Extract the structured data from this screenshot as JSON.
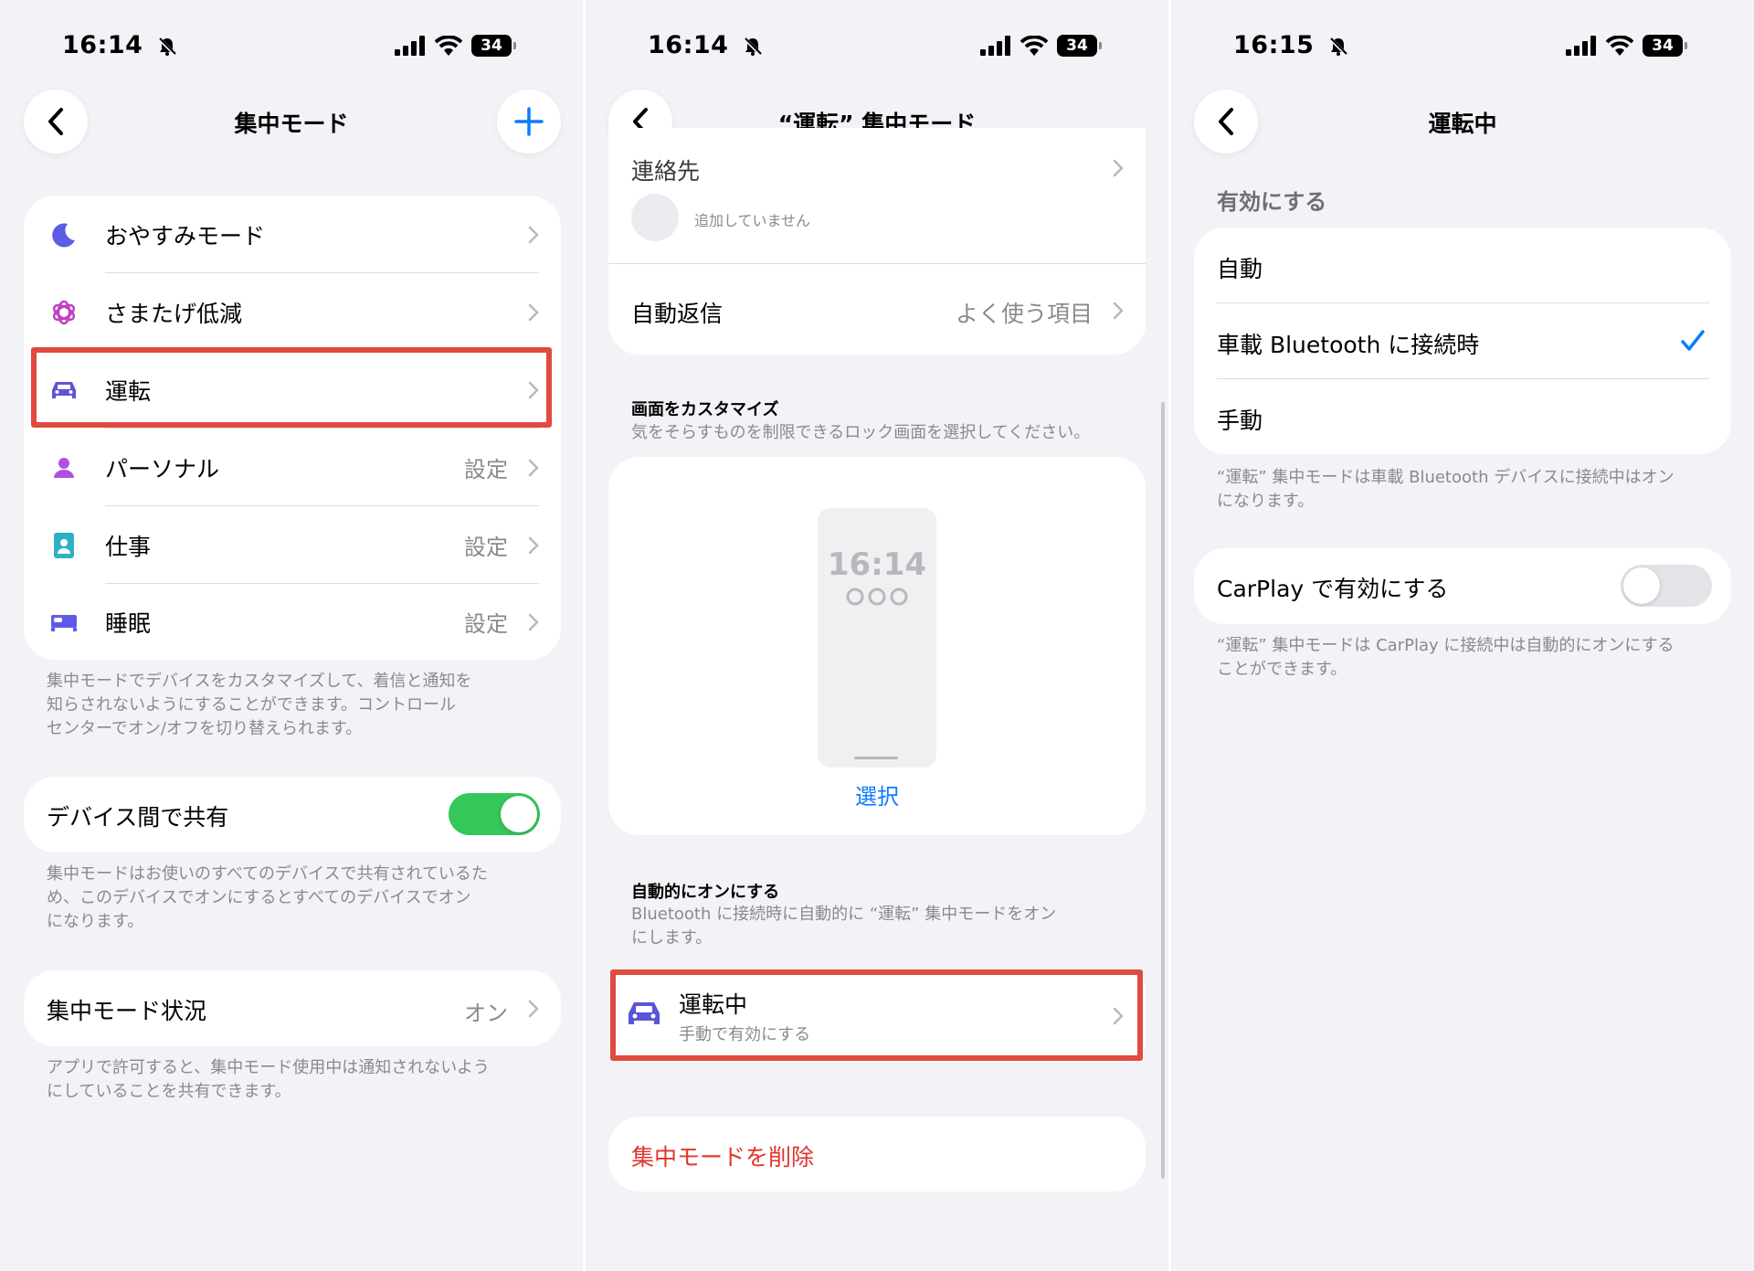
{
  "colors": {
    "accent_blue": "#0a7cff",
    "moon_purple": "#5e5ce6",
    "mindful_magenta": "#bf40bf",
    "car_indigo": "#5a55d6",
    "personal_purple": "#af52de",
    "work_teal": "#30b0c7",
    "sleep_indigo": "#5e5ce6",
    "toggle_green": "#34c759",
    "toggle_off": "#e4e4e8",
    "delete_red": "#e0352b",
    "highlight_red": "#e04a3f"
  },
  "screen1": {
    "status_time": "16:14",
    "battery": "34",
    "title": "集中モード",
    "modes": [
      {
        "icon": "moon-icon",
        "label": "おやすみモード",
        "value": ""
      },
      {
        "icon": "mindfulness-icon",
        "label": "さまたげ低減",
        "value": ""
      },
      {
        "icon": "car-icon",
        "label": "運転",
        "value": ""
      },
      {
        "icon": "person-icon",
        "label": "パーソナル",
        "value": "設定"
      },
      {
        "icon": "id-badge-icon",
        "label": "仕事",
        "value": "設定"
      },
      {
        "icon": "bed-icon",
        "label": "睡眠",
        "value": "設定"
      }
    ],
    "modes_footnote": "集中モードでデバイスをカスタマイズして、着信と通知を\n知らされないようにすることができます。コントロール\nセンターでオン/オフを切り替えられます。",
    "share_label": "デバイス間で共有",
    "share_on": true,
    "share_footnote": "集中モードはお使いのすべてのデバイスで共有されているた\nめ、このデバイスでオンにするとすべてのデバイスでオン\nになります。",
    "status_label": "集中モード状況",
    "status_value": "オン",
    "status_footnote": "アプリで許可すると、集中モード使用中は通知されないよう\nにしていることを共有できます。"
  },
  "screen2": {
    "status_time": "16:14",
    "battery": "34",
    "title": "“運転” 集中モード",
    "contacts_label": "連絡先",
    "contacts_empty": "追加していません",
    "autoreply_label": "自動返信",
    "autoreply_value": "よく使う項目",
    "customize_head": "画面をカスタマイズ",
    "customize_sub": "気をそらすものを制限できるロック画面を選択してください。",
    "lock_time": "16:14",
    "select_label": "選択",
    "auto_head": "自動的にオンにする",
    "auto_sub": "Bluetooth に接続時に自動的に “運転” 集中モードをオン\nにします。",
    "driving_title": "運転中",
    "driving_sub": "手動で有効にする",
    "delete_label": "集中モードを削除"
  },
  "screen3": {
    "status_time": "16:15",
    "battery": "34",
    "title": "運転中",
    "enable_head": "有効にする",
    "options": [
      {
        "label": "自動",
        "checked": false
      },
      {
        "label": "車載 Bluetooth に接続時",
        "checked": true
      },
      {
        "label": "手動",
        "checked": false
      }
    ],
    "options_footnote": "“運転” 集中モードは車載 Bluetooth デバイスに接続中はオン\nになります。",
    "carplay_label": "CarPlay で有効にする",
    "carplay_on": false,
    "carplay_footnote": "“運転” 集中モードは CarPlay に接続中は自動的にオンにする\nことができます。"
  }
}
